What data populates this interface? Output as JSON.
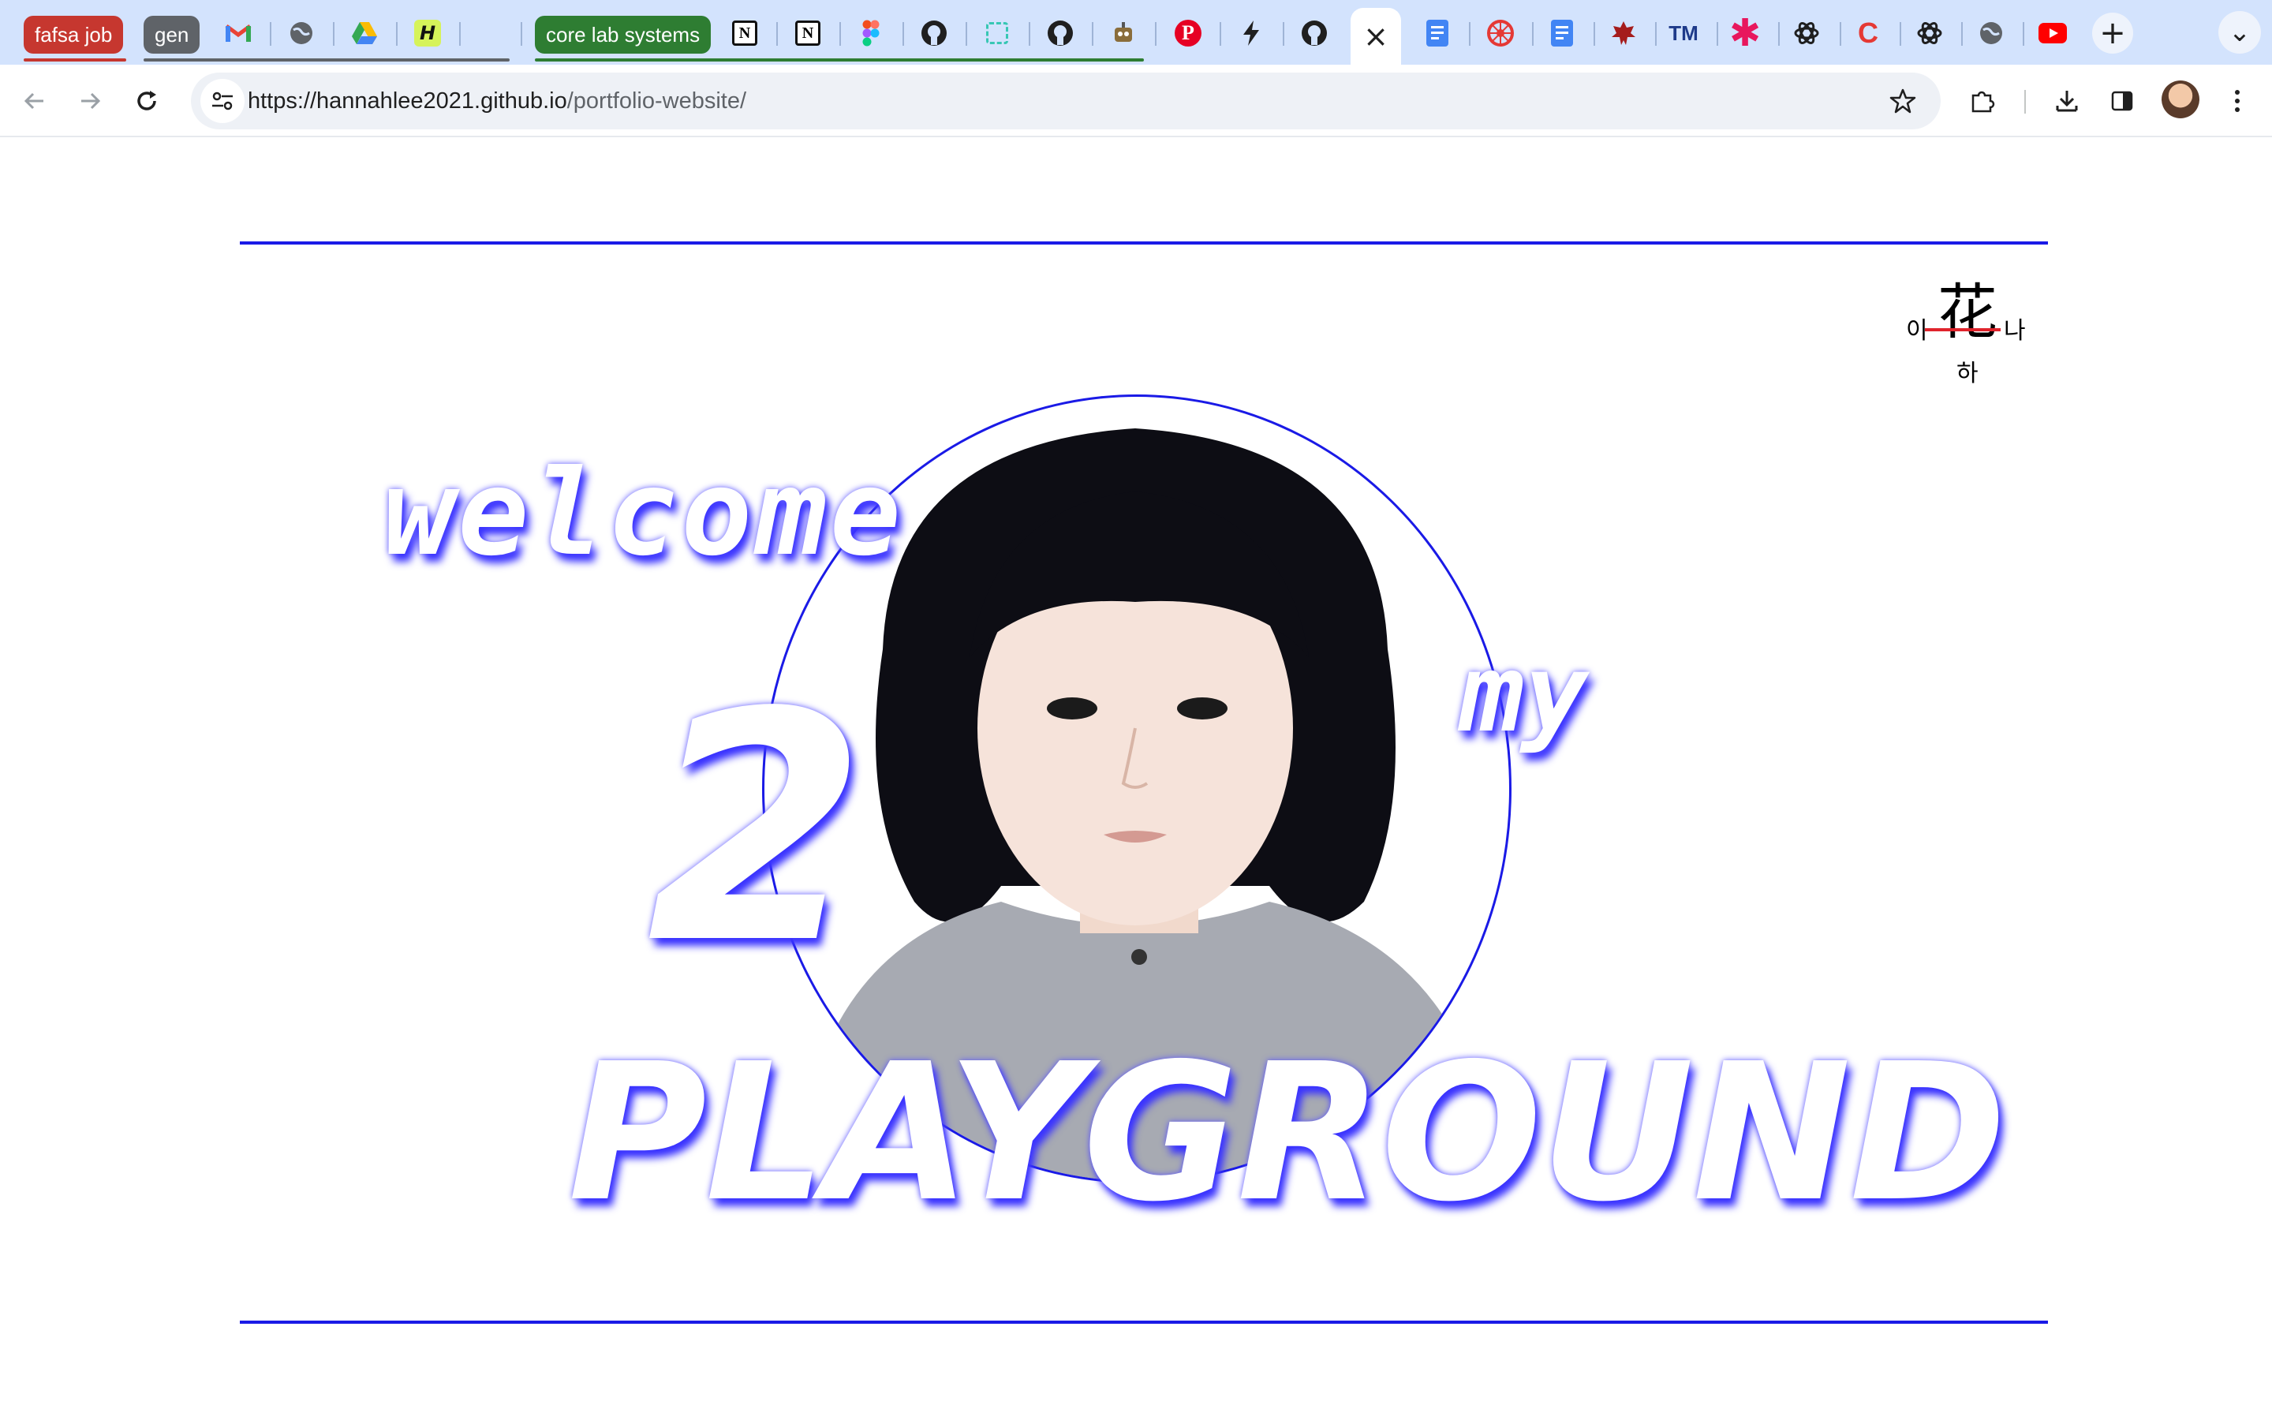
{
  "browser": {
    "tab_groups": [
      {
        "label": "fafsa job",
        "color": "#c6372f"
      },
      {
        "label": "gen",
        "color": "#5f6368"
      },
      {
        "label": "core lab systems",
        "color": "#2e7d32"
      }
    ],
    "tab_icons": [
      "gmail-icon",
      "globe-icon",
      "google-drive-icon",
      "h-app-icon",
      "blank-tab-icon",
      "notion-icon",
      "notion-icon",
      "figma-icon",
      "github-icon",
      "dashed-square-icon",
      "github-icon",
      "robot-icon",
      "pinterest-icon",
      "bolt-icon",
      "github-icon",
      "google-docs-icon",
      "ucla-icon",
      "google-docs-icon",
      "maple-leaf-icon",
      "tm-icon",
      "asterisk-icon",
      "openai-icon",
      "c-icon",
      "openai-icon",
      "globe-icon",
      "youtube-icon"
    ],
    "active_tab_close": "×",
    "new_tab": "+",
    "tab_list": "⌄",
    "url_host": "https://hannahlee2021.github.io",
    "url_path": "/portfolio-website/",
    "colors": {
      "tabstrip": "#d3e3fd",
      "accent": "#1a1ae6"
    }
  },
  "logo": {
    "left": "이",
    "center": "花",
    "right": "나",
    "bottom": "하"
  },
  "hero": {
    "line1": "welcome",
    "line2": "2",
    "line3": "my",
    "line4": "PLAYGROUND",
    "photo": "portrait-photo"
  }
}
